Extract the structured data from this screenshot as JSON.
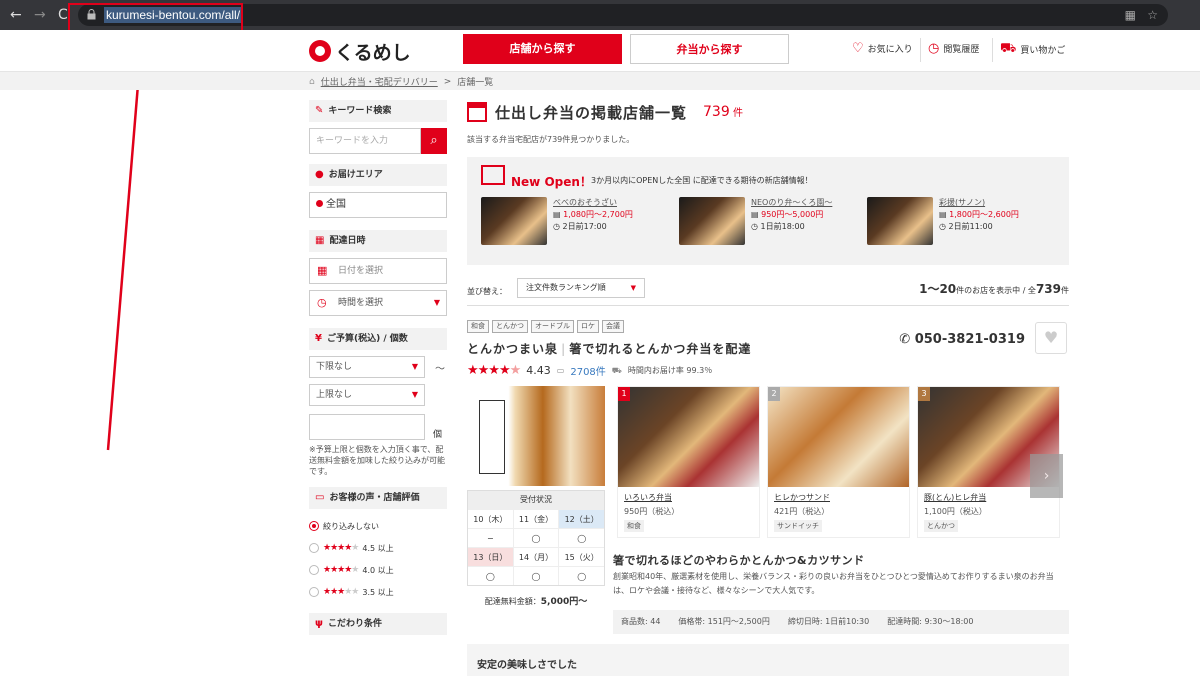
{
  "browser": {
    "back": "←",
    "forward": "→",
    "reload": "C",
    "url": "kurumesi-bentou.com/all/"
  },
  "header": {
    "logo_text": "くるめし",
    "tab_shop": "店舗から探す",
    "tab_bento": "弁当から探す",
    "favorites": "お気に入り",
    "history": "閲覧履歴",
    "cart": "買い物かご"
  },
  "breadcrumb": {
    "home": "仕出し弁当・宅配デリバリー",
    "sep": ">",
    "current": "店舗一覧"
  },
  "sidebar": {
    "keyword": {
      "title": "キーワード検索",
      "placeholder": "キーワードを入力"
    },
    "area": {
      "title": "お届けエリア",
      "value": "全国"
    },
    "date": {
      "title": "配達日時",
      "date_placeholder": "日付を選択",
      "time_placeholder": "時間を選択"
    },
    "budget": {
      "title": "ご予算(税込) / 個数",
      "min": "下限なし",
      "max": "上限なし",
      "tilde": "〜",
      "unit": "個",
      "note": "※予算上限と個数を入力頂く事で、配送無料金額を加味した絞り込みが可能です。"
    },
    "review": {
      "title": "お客様の声・店舗評価",
      "none": "絞り込みしない",
      "opt45": "4.5 以上",
      "opt40": "4.0 以上",
      "opt35": "3.5 以上"
    },
    "more": {
      "title": "こだわり条件"
    }
  },
  "main": {
    "title": "仕出し弁当の掲載店舗一覧",
    "count": "739",
    "count_unit": "件",
    "result_note": "該当する弁当宅配店が739件見つかりました。",
    "newopen": {
      "label": "New Open！",
      "desc": "3か月以内にOPENした全国 に配達できる期待の新店舗情報！",
      "items": [
        {
          "name": "べべのおそうざい",
          "price": "1,080円〜2,700円",
          "deadline": "2日前17:00"
        },
        {
          "name": "NEOのり弁〜くろ園〜",
          "price": "950円〜5,000円",
          "deadline": "1日前18:00"
        },
        {
          "name": "彩援(サノン)",
          "price": "1,800円〜2,600円",
          "deadline": "2日前11:00"
        }
      ]
    },
    "sort": {
      "label": "並び替え：",
      "value": "注文件数ランキング順"
    },
    "range": {
      "text": "1〜20",
      "mid": "件のお店を表示中 / 全",
      "total": "739",
      "unit": "件"
    },
    "shop": {
      "tags": [
        "和食",
        "とんかつ",
        "オードブル",
        "ロケ",
        "会議"
      ],
      "name": "とんかつまい泉",
      "catch_title": "箸で切れるとんかつ弁当を配達",
      "phone": "050-3821-0319",
      "rating": "4.43",
      "reviews": "2708件",
      "ontime": "時間内お届け率 99.3％",
      "avail": {
        "header": "受付状況",
        "row1": [
          "10（木）",
          "11（金）",
          "12（土）"
        ],
        "row2": [
          "−",
          "◯",
          "◯"
        ],
        "row3": [
          "13（日）",
          "14（月）",
          "15（火）"
        ],
        "row4": [
          "◯",
          "◯",
          "◯"
        ]
      },
      "free_ship_label": "配達無料金額：",
      "free_ship_value": "5,000円〜",
      "products": [
        {
          "rank": "1",
          "name": "いろいろ弁当",
          "price": "950円",
          "tax": "（税込）",
          "tag": "和食"
        },
        {
          "rank": "2",
          "name": "ヒレかつサンド",
          "price": "421円",
          "tax": "（税込）",
          "tag": "サンドイッチ"
        },
        {
          "rank": "3",
          "name": "豚(とん)ヒレ弁当",
          "price": "1,100円",
          "tax": "（税込）",
          "tag": "とんかつ"
        }
      ],
      "catch": "箸で切れるほどのやわらかとんかつ&カツサンド",
      "desc": "創業昭和40年、厳選素材を使用し、栄養バランス・彩りの良いお弁当をひとつひとつ愛情込めてお作りするまい泉のお弁当は、ロケや会議・接待など、様々なシーンで大人気です。",
      "stats": [
        "商品数: 44",
        "価格帯: 151円〜2,500円",
        "締切日時: 1日前10:30",
        "配達時間: 9:30〜18:00"
      ]
    },
    "next_shop": "安定の美味しさでした"
  },
  "colors": {
    "accent": "#e0001a"
  }
}
